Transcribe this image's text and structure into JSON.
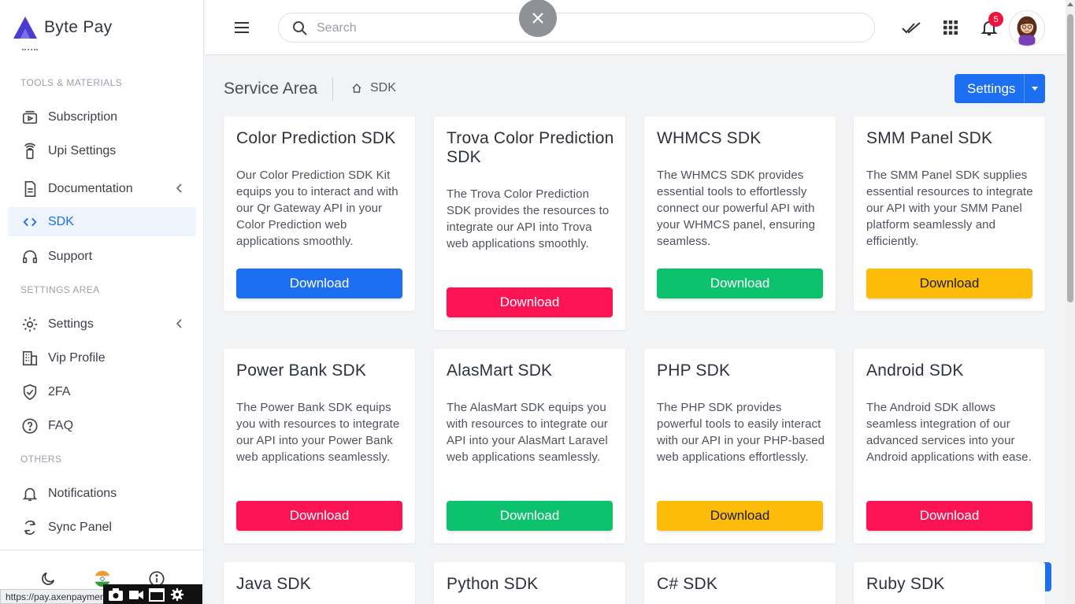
{
  "brand": {
    "name": "Byte Pay",
    "color": "#4b3bd1"
  },
  "sidebar": {
    "sections": [
      "TOOLS & MATERIALS",
      "SETTINGS AREA",
      "OTHERS"
    ],
    "items": [
      {
        "label": "Subscription",
        "icon": "subscription-icon"
      },
      {
        "label": "Upi Settings",
        "icon": "upi-icon"
      },
      {
        "label": "Documentation",
        "icon": "document-icon"
      },
      {
        "label": "SDK",
        "icon": "code-icon",
        "active": true
      },
      {
        "label": "Support",
        "icon": "headset-icon"
      },
      {
        "label": "Settings",
        "icon": "gear-icon"
      },
      {
        "label": "Vip Profile",
        "icon": "building-icon"
      },
      {
        "label": "2FA",
        "icon": "shield-check-icon"
      },
      {
        "label": "FAQ",
        "icon": "question-icon"
      },
      {
        "label": "Notifications",
        "icon": "bell-icon"
      },
      {
        "label": "Sync Panel",
        "icon": "sync-icon"
      }
    ]
  },
  "status_url": "https://pay.axenpaymen",
  "header": {
    "search_placeholder": "Search",
    "notification_count": "5"
  },
  "page": {
    "title": "Service Area",
    "breadcrumb": "SDK",
    "settings_label": "Settings"
  },
  "colors": {
    "blue": "#1d6ff2",
    "red": "#fb1354",
    "green": "#0cc26d",
    "yellow": "#fdbb0a"
  },
  "cards": [
    {
      "title": "Color Prediction SDK",
      "desc": "Our Color Prediction SDK Kit equips you to interact and with our Qr Gateway API in your Color Prediction web applications smoothly.",
      "button": "Download",
      "color": "blue"
    },
    {
      "title": "Trova Color Prediction SDK",
      "desc": "The Trova Color Prediction SDK provides the resources to integrate our API into Trova web applications smoothly.",
      "button": "Download",
      "color": "red"
    },
    {
      "title": "WHMCS SDK",
      "desc": "The WHMCS SDK provides essential tools to effortlessly connect our powerful API with your WHMCS panel, ensuring seamless.",
      "button": "Download",
      "color": "green"
    },
    {
      "title": "SMM Panel SDK",
      "desc": "The SMM Panel SDK supplies essential resources to integrate our API with your SMM Panel platform seamlessly and efficiently.",
      "button": "Download",
      "color": "yellow"
    },
    {
      "title": "Power Bank SDK",
      "desc": "The Power Bank SDK equips you with resources to integrate our API into your Power Bank web applications seamlessly.",
      "button": "Download",
      "color": "red"
    },
    {
      "title": "AlasMart SDK",
      "desc": "The AlasMart SDK equips you with resources to integrate our API into your AlasMart Laravel web applications seamlessly.",
      "button": "Download",
      "color": "green"
    },
    {
      "title": "PHP SDK",
      "desc": "The PHP SDK provides powerful tools to easily interact with our API in your PHP-based web applications effortlessly.",
      "button": "Download",
      "color": "yellow"
    },
    {
      "title": "Android SDK",
      "desc": "The Android SDK allows seamless integration of our advanced services into your Android applications with ease.",
      "button": "Download",
      "color": "red"
    },
    {
      "title": "Java SDK"
    },
    {
      "title": "Python SDK"
    },
    {
      "title": "C# SDK"
    },
    {
      "title": "Ruby SDK"
    }
  ]
}
